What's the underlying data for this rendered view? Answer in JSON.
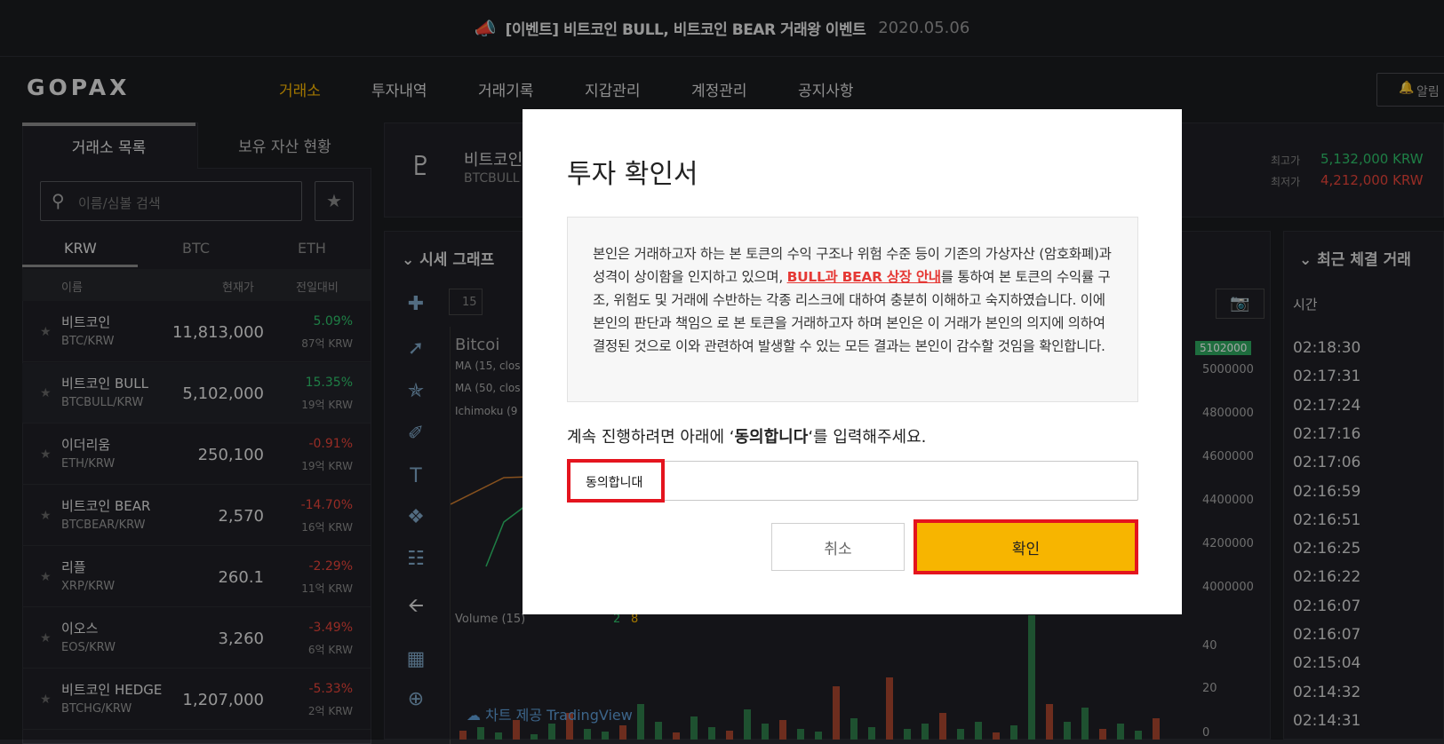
{
  "banner": {
    "icon": "megaphone-icon",
    "text": "[이벤트] 비트코인 BULL, 비트코인 BEAR 거래왕 이벤트",
    "date": "2020.05.06"
  },
  "header": {
    "logo": "GOPAX",
    "nav": [
      "거래소",
      "투자내역",
      "거래기록",
      "지갑관리",
      "계정관리",
      "공지사항"
    ],
    "alarm": "알림"
  },
  "sidebar": {
    "tabs": [
      "거래소 목록",
      "보유 자산 현황"
    ],
    "search_placeholder": "이름/심볼 검색",
    "currency_tabs": [
      "KRW",
      "BTC",
      "ETH"
    ],
    "columns": [
      "이름",
      "현재가",
      "전일대비"
    ],
    "rows": [
      {
        "name": "비트코인",
        "symbol": "BTC/KRW",
        "price": "11,813,000",
        "change": "5.09%",
        "volume": "87억 KRW",
        "dir": "up"
      },
      {
        "name": "비트코인 BULL",
        "symbol": "BTCBULL/KRW",
        "price": "5,102,000",
        "change": "15.35%",
        "volume": "19억 KRW",
        "dir": "up"
      },
      {
        "name": "이더리움",
        "symbol": "ETH/KRW",
        "price": "250,100",
        "change": "-0.91%",
        "volume": "19억 KRW",
        "dir": "down"
      },
      {
        "name": "비트코인 BEAR",
        "symbol": "BTCBEAR/KRW",
        "price": "2,570",
        "change": "-14.70%",
        "volume": "16억 KRW",
        "dir": "down"
      },
      {
        "name": "리플",
        "symbol": "XRP/KRW",
        "price": "260.1",
        "change": "-2.29%",
        "volume": "11억 KRW",
        "dir": "down"
      },
      {
        "name": "이오스",
        "symbol": "EOS/KRW",
        "price": "3,260",
        "change": "-3.49%",
        "volume": "6억 KRW",
        "dir": "down"
      },
      {
        "name": "비트코인 HEDGE",
        "symbol": "BTCHG/KRW",
        "price": "1,207,000",
        "change": "-5.33%",
        "volume": "2억 KRW",
        "dir": "down"
      }
    ]
  },
  "ticker": {
    "name": "비트코인",
    "symbol": "BTCBULL",
    "high_label": "최고가",
    "high": "5,132,000 KRW",
    "low_label": "최저가",
    "low": "4,212,000 KRW"
  },
  "chart": {
    "title": "시세 그래프",
    "interval": "15",
    "legend": [
      "Bitcoi",
      "MA (15, clos",
      "MA (50, clos",
      "Ichimoku (9"
    ],
    "price_tag": "5102000",
    "y_ticks": [
      "5000000",
      "4800000",
      "4600000",
      "4400000",
      "4200000",
      "4000000"
    ],
    "volume_label": "Volume (15)",
    "volume_vals": [
      "2",
      "8"
    ],
    "vol_ticks": [
      "40",
      "20",
      "0"
    ],
    "credit": "차트 제공 TradingView"
  },
  "trades": {
    "title": "최근 체결 거래",
    "col": "시간",
    "times": [
      "02:18:30",
      "02:17:31",
      "02:17:24",
      "02:17:16",
      "02:17:06",
      "02:16:59",
      "02:16:51",
      "02:16:25",
      "02:16:22",
      "02:16:07",
      "02:16:07",
      "02:15:04",
      "02:14:32",
      "02:14:31"
    ]
  },
  "modal": {
    "title": "투자 확인서",
    "body_1": "본인은 거래하고자 하는 본 토큰의 수익 구조나 위험 수준 등이 기존의 가상자산 (암호화폐)과 성격이 상이함을 인지하고 있으며, ",
    "body_link": "BULL과 BEAR 상장 안내",
    "body_2": "를 통하여 본 토큰의 수익률 구조, 위험도 및 거래에 수반하는 각종 리스크에 대하여 충분히 이해하고 숙지하였습니다. 이에 본인의 판단과 책임으 로 본 토큰을 거래하고자 하며 본인은 이 거래가 본인의 의지에 의하여 결정된 것으로 이와 관련하여 발생할 수 있는 모든 결과는 본인이 감수할 것임을 확인합니다.",
    "instr_pre": "계속 진행하려면 아래에 ‘",
    "instr_bold": "동의합니다",
    "instr_post": "‘를 입력해주세요.",
    "input_value": "동의합니대",
    "cancel": "취소",
    "ok": "확인"
  }
}
